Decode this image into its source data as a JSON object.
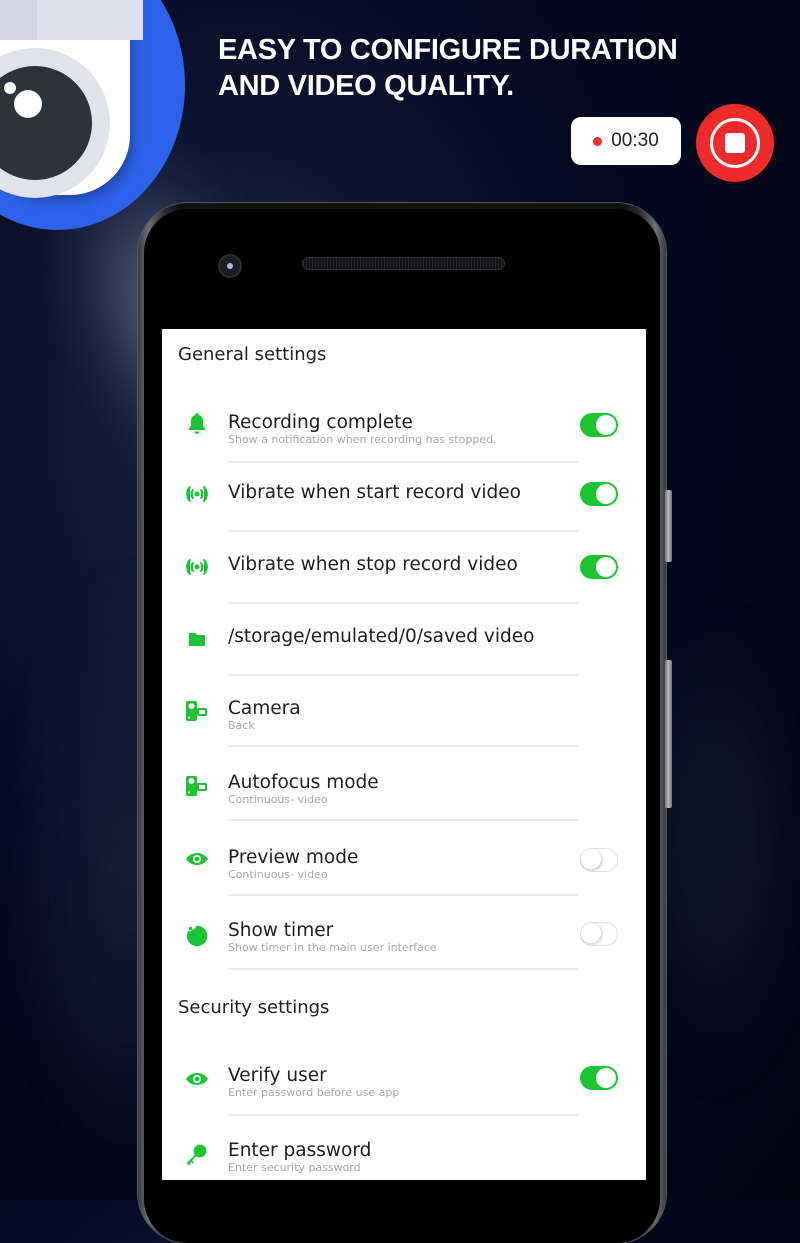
{
  "promo": {
    "headline_line1": "EASY TO CONFIGURE DURATION",
    "headline_line2": "AND VIDEO QUALITY.",
    "timer": "00:30",
    "accent_color": "#2d62ea",
    "record_color": "#ee2a2a"
  },
  "settings": {
    "accent_color": "#1cc434",
    "general_title": "General settings",
    "security_title": "Security settings",
    "general_items": [
      {
        "icon": "bell-icon",
        "title": "Recording complete",
        "subtitle": "Show a notification when recording has stopped.",
        "toggle": true
      },
      {
        "icon": "vibrate-icon",
        "title": "Vibrate when start record video",
        "subtitle": "",
        "toggle": true
      },
      {
        "icon": "vibrate-icon",
        "title": "Vibrate when stop record video",
        "subtitle": "",
        "toggle": true
      },
      {
        "icon": "folder-icon",
        "title": "/storage/emulated/0/saved video",
        "subtitle": "",
        "toggle": null
      },
      {
        "icon": "video-camera-icon",
        "title": "Camera",
        "subtitle": "Back",
        "toggle": null
      },
      {
        "icon": "video-camera-icon",
        "title": "Autofocus mode",
        "subtitle": "Continuous- video",
        "toggle": null
      },
      {
        "icon": "eye-icon",
        "title": "Preview mode",
        "subtitle": "Continuous- video",
        "toggle": false
      },
      {
        "icon": "timer-icon",
        "title": "Show timer",
        "subtitle": "Show timer in the main user interface",
        "toggle": false
      }
    ],
    "security_items": [
      {
        "icon": "eye-icon",
        "title": "Verify user",
        "subtitle": "Enter password before use app",
        "toggle": true
      },
      {
        "icon": "key-icon",
        "title": "Enter password",
        "subtitle": "Enter security password",
        "toggle": null
      }
    ]
  }
}
